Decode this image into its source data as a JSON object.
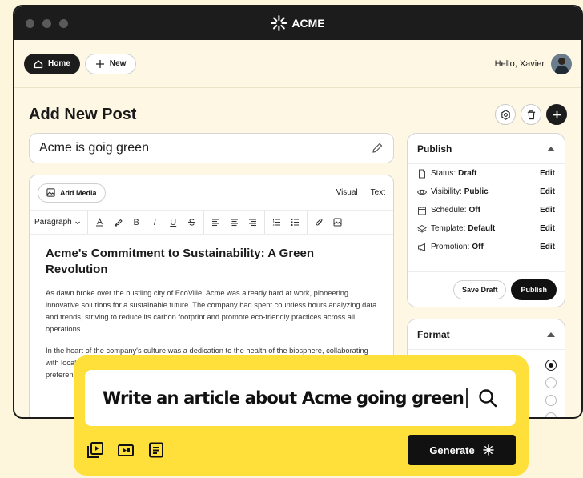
{
  "app": {
    "brand": "ACME"
  },
  "nav": {
    "home_label": "Home",
    "new_label": "New",
    "greeting": "Hello, Xavier"
  },
  "page": {
    "title": "Add New Post"
  },
  "post": {
    "title_value": "Acme is goig green"
  },
  "editor": {
    "add_media_label": "Add Media",
    "tab_visual": "Visual",
    "tab_text": "Text",
    "paragraph_select": "Paragraph",
    "toolbar": {
      "bold": "B",
      "italic": "I",
      "underline": "U"
    },
    "heading": "Acme's Commitment to Sustainability: A Green Revolution",
    "paragraph1": "As dawn broke over the bustling city of EcoVille, Acme was already hard at work, pioneering innovative solutions for a sustainable future. The company had spent countless hours analyzing data and trends, striving to reduce its carbon footprint and promote eco-friendly practices across all operations.",
    "paragraph2": "In the heart of the company's culture was a dedication to the health of the biosphere, collaborating with local organizations to improve the well-being of communities. Sudden shifts in consumer preferences made it clear that the path forward had to be sustainable."
  },
  "publish": {
    "title": "Publish",
    "rows": [
      {
        "label": "Status:",
        "value": "Draft",
        "action": "Edit",
        "icon": "document-icon"
      },
      {
        "label": "Visibility:",
        "value": "Public",
        "action": "Edit",
        "icon": "eye-icon"
      },
      {
        "label": "Schedule:",
        "value": "Off",
        "action": "Edit",
        "icon": "calendar-icon"
      },
      {
        "label": "Template:",
        "value": "Default",
        "action": "Edit",
        "icon": "layers-icon"
      },
      {
        "label": "Promotion:",
        "value": "Off",
        "action": "Edit",
        "icon": "megaphone-icon"
      }
    ],
    "save_draft_label": "Save Draft",
    "publish_label": "Publish"
  },
  "format": {
    "title": "Format"
  },
  "ai": {
    "prompt_value": "Write an article about Acme going green",
    "generate_label": "Generate"
  }
}
